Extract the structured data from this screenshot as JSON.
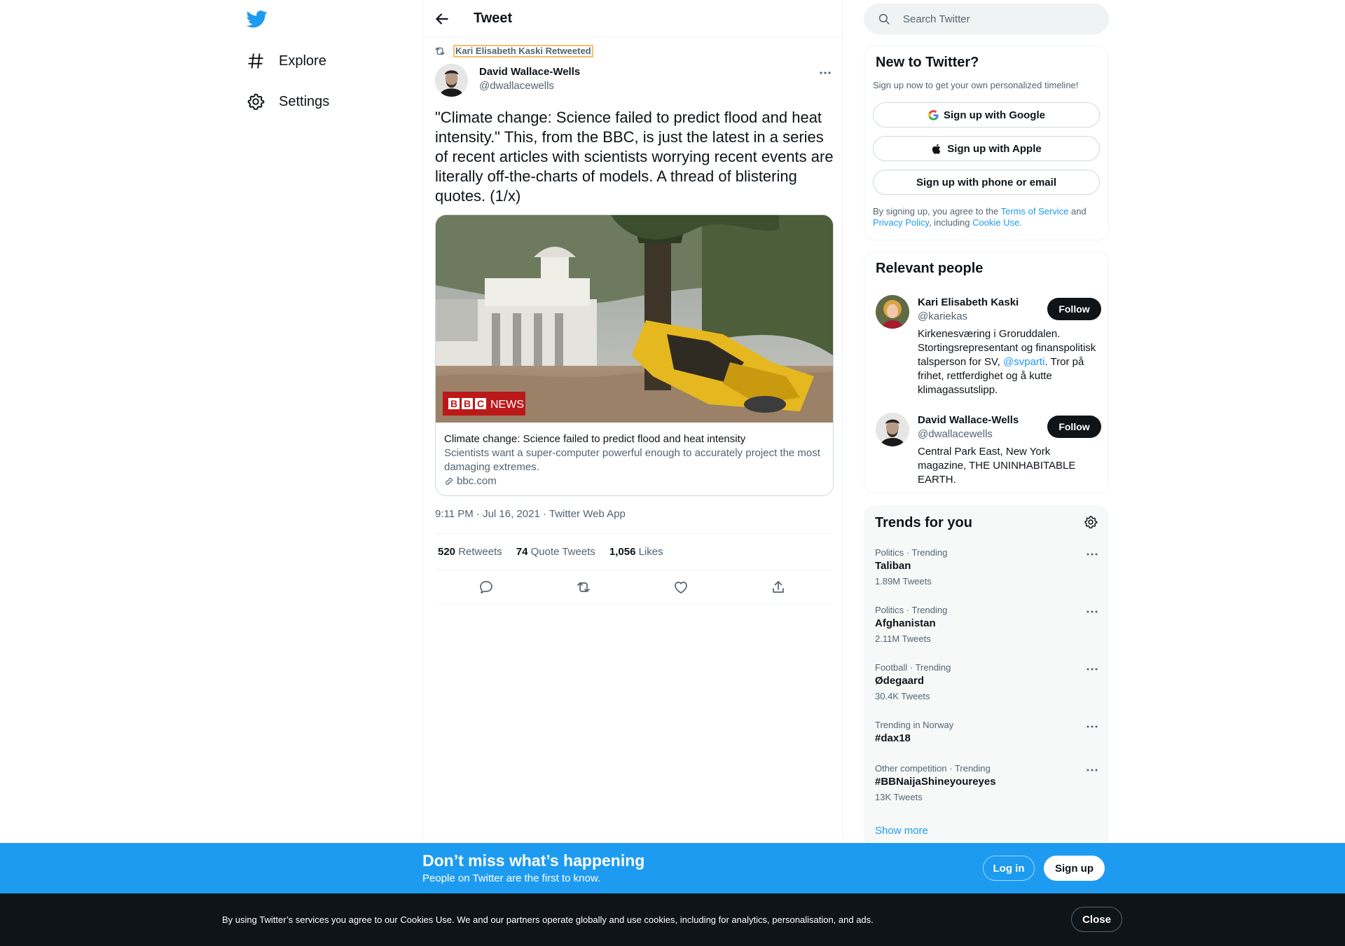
{
  "nav": {
    "items": [
      {
        "label": "Explore",
        "icon": "hashtag-icon"
      },
      {
        "label": "Settings",
        "icon": "gear-icon"
      }
    ]
  },
  "header": {
    "title": "Tweet"
  },
  "tweet": {
    "retweeted_by": "Kari Elisabeth Kaski Retweeted",
    "author_name": "David Wallace-Wells",
    "author_handle": "@dwallacewells",
    "text": "\"Climate change: Science failed to predict flood and heat intensity.\" This, from the BBC, is just the latest in a series of recent articles with scientists worrying recent events are literally off-the-charts of models. A thread of blistering quotes. (1/x)",
    "card": {
      "badge_left": "BBC",
      "badge_right": "NEWS",
      "title": "Climate change: Science failed to predict flood and heat intensity",
      "description": "Scientists want a super-computer powerful enough to accurately project the most damaging extremes.",
      "domain": "bbc.com"
    },
    "timestamp": "9:11 PM · Jul 16, 2021 · Twitter Web App",
    "stats": {
      "retweets_num": "520",
      "retweets_label": "Retweets",
      "quotes_num": "74",
      "quotes_label": "Quote Tweets",
      "likes_num": "1,056",
      "likes_label": "Likes"
    }
  },
  "search": {
    "placeholder": "Search Twitter"
  },
  "new_to_twitter": {
    "title": "New to Twitter?",
    "subtitle": "Sign up now to get your own personalized timeline!",
    "google": "Sign up with Google",
    "apple": "Sign up with Apple",
    "phone": "Sign up with phone or email",
    "legal_1": "By signing up, you agree to the ",
    "terms": "Terms of Service",
    "legal_2": " and",
    "privacy": "Privacy Policy",
    "legal_3": ", including ",
    "cookie": "Cookie Use."
  },
  "relevant_people": {
    "title": "Relevant people",
    "people": [
      {
        "name": "Kari Elisabeth Kaski",
        "handle": "@kariekas",
        "bio_1": "Kirkenesværing i Groruddalen. Stortingsrepresentant og finanspolitisk talsperson for SV, ",
        "mention": "@svparti",
        "bio_2": ". Tror på frihet, rettferdighet og å kutte klimagassutslipp.",
        "follow": "Follow"
      },
      {
        "name": "David Wallace-Wells",
        "handle": "@dwallacewells",
        "bio_1": "Central Park East, New York magazine, THE UNINHABITABLE EARTH.",
        "follow": "Follow"
      }
    ]
  },
  "trends": {
    "title": "Trends for you",
    "items": [
      {
        "context": "Politics · Trending",
        "name": "Taliban",
        "count": "1.89M Tweets"
      },
      {
        "context": "Politics · Trending",
        "name": "Afghanistan",
        "count": "2.11M Tweets"
      },
      {
        "context": "Football · Trending",
        "name": "Ødegaard",
        "count": "30.4K Tweets"
      },
      {
        "context": "Trending in Norway",
        "name": "#dax18",
        "count": ""
      },
      {
        "context": "Other competition · Trending",
        "name": "#BBNaijaShineyoureyes",
        "count": "13K Tweets"
      }
    ],
    "show_more": "Show more"
  },
  "banner": {
    "title": "Don’t miss what’s happening",
    "subtitle": "People on Twitter are the first to know.",
    "login": "Log in",
    "signup": "Sign up"
  },
  "cookie_bar": {
    "text": "By using Twitter’s services you agree to our Cookies Use. We and our partners operate globally and use cookies, including for analytics, personalisation, and ads.",
    "close": "Close"
  },
  "colors": {
    "accent": "#1d9bf0",
    "text": "#0f1419",
    "secondary": "#536471",
    "bbc_red": "#bb1919"
  }
}
